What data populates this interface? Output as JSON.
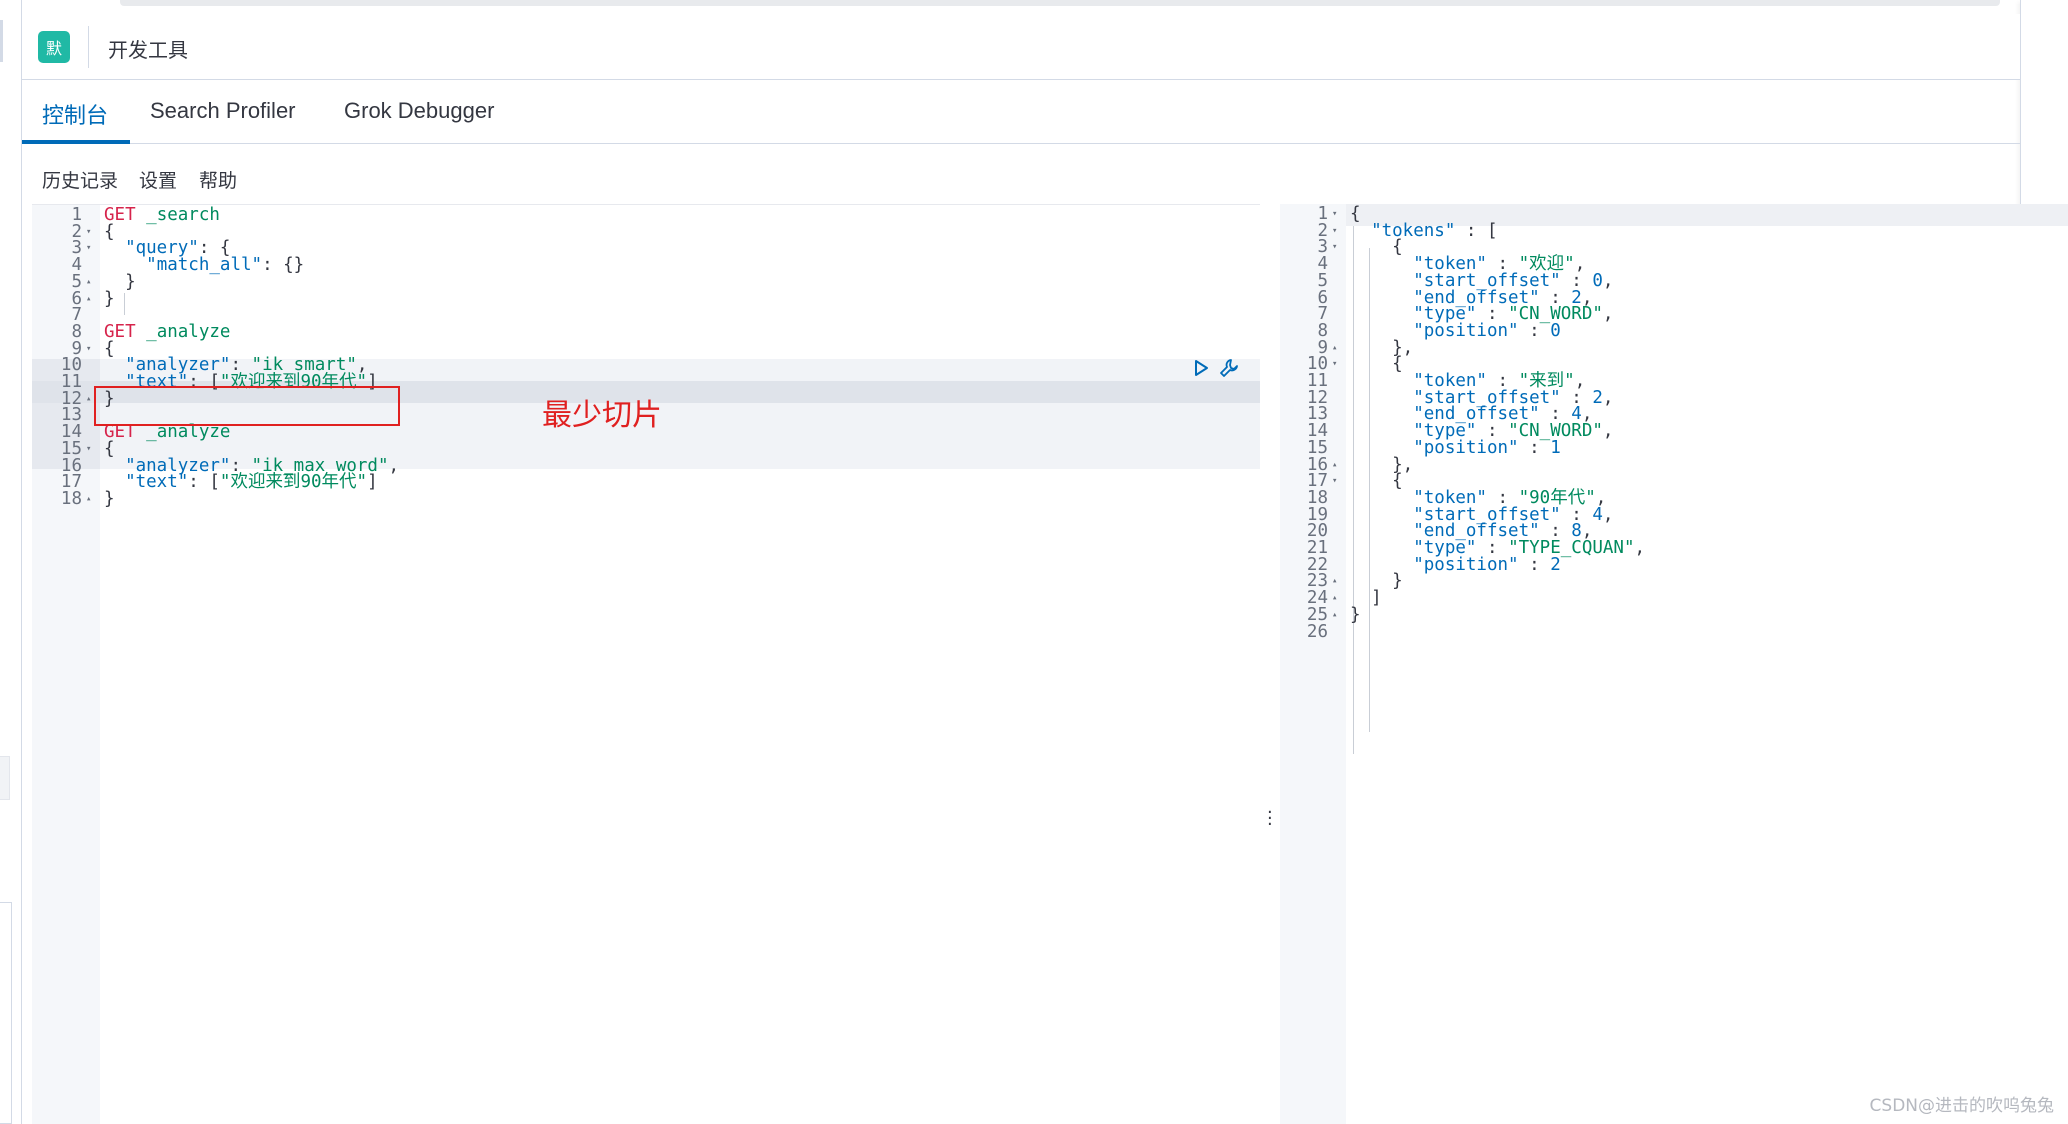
{
  "header": {
    "space_badge": "默",
    "title": "开发工具"
  },
  "tabs": [
    {
      "label": "控制台",
      "active": true
    },
    {
      "label": "Search Profiler",
      "active": false
    },
    {
      "label": "Grok Debugger",
      "active": false
    }
  ],
  "menu": {
    "history": "历史记录",
    "settings": "设置",
    "help": "帮助"
  },
  "annotation": "最少切片",
  "watermark": "CSDN@进击的吹呜兔兔",
  "icons": {
    "run": "play-icon",
    "wrench": "wrench-icon",
    "resize": "vertical-dots-icon"
  },
  "colors": {
    "accent": "#006bb8",
    "method": "#d6234b",
    "string": "#008a5e",
    "annotation": "#e02020",
    "badge": "#20b9a5"
  },
  "request_lines": [
    {
      "n": "1",
      "fold": "",
      "text": "GET _search"
    },
    {
      "n": "2",
      "fold": "▾",
      "text": "{"
    },
    {
      "n": "3",
      "fold": "▾",
      "text": "  \"query\": {"
    },
    {
      "n": "4",
      "fold": "",
      "text": "    \"match_all\": {}"
    },
    {
      "n": "5",
      "fold": "▴",
      "text": "  }"
    },
    {
      "n": "6",
      "fold": "▴",
      "text": "}"
    },
    {
      "n": "7",
      "fold": "",
      "text": ""
    },
    {
      "n": "8",
      "fold": "",
      "text": "GET _analyze"
    },
    {
      "n": "9",
      "fold": "▾",
      "text": "{"
    },
    {
      "n": "10",
      "fold": "",
      "text": "  \"analyzer\": \"ik_smart\","
    },
    {
      "n": "11",
      "fold": "",
      "text": "  \"text\": [\"欢迎来到90年代\"]"
    },
    {
      "n": "12",
      "fold": "▴",
      "text": "}"
    },
    {
      "n": "13",
      "fold": "",
      "text": ""
    },
    {
      "n": "14",
      "fold": "",
      "text": "GET _analyze"
    },
    {
      "n": "15",
      "fold": "▾",
      "text": "{"
    },
    {
      "n": "16",
      "fold": "",
      "text": "  \"analyzer\": \"ik_max_word\","
    },
    {
      "n": "17",
      "fold": "",
      "text": "  \"text\": [\"欢迎来到90年代\"]"
    },
    {
      "n": "18",
      "fold": "▴",
      "text": "}"
    }
  ],
  "response_lines": [
    {
      "n": "1",
      "fold": "▾",
      "text": "{"
    },
    {
      "n": "2",
      "fold": "▾",
      "text": "  \"tokens\" : ["
    },
    {
      "n": "3",
      "fold": "▾",
      "text": "    {"
    },
    {
      "n": "4",
      "fold": "",
      "text": "      \"token\" : \"欢迎\","
    },
    {
      "n": "5",
      "fold": "",
      "text": "      \"start_offset\" : 0,"
    },
    {
      "n": "6",
      "fold": "",
      "text": "      \"end_offset\" : 2,"
    },
    {
      "n": "7",
      "fold": "",
      "text": "      \"type\" : \"CN_WORD\","
    },
    {
      "n": "8",
      "fold": "",
      "text": "      \"position\" : 0"
    },
    {
      "n": "9",
      "fold": "▴",
      "text": "    },"
    },
    {
      "n": "10",
      "fold": "▾",
      "text": "    {"
    },
    {
      "n": "11",
      "fold": "",
      "text": "      \"token\" : \"来到\","
    },
    {
      "n": "12",
      "fold": "",
      "text": "      \"start_offset\" : 2,"
    },
    {
      "n": "13",
      "fold": "",
      "text": "      \"end_offset\" : 4,"
    },
    {
      "n": "14",
      "fold": "",
      "text": "      \"type\" : \"CN_WORD\","
    },
    {
      "n": "15",
      "fold": "",
      "text": "      \"position\" : 1"
    },
    {
      "n": "16",
      "fold": "▴",
      "text": "    },"
    },
    {
      "n": "17",
      "fold": "▾",
      "text": "    {"
    },
    {
      "n": "18",
      "fold": "",
      "text": "      \"token\" : \"90年代\","
    },
    {
      "n": "19",
      "fold": "",
      "text": "      \"start_offset\" : 4,"
    },
    {
      "n": "20",
      "fold": "",
      "text": "      \"end_offset\" : 8,"
    },
    {
      "n": "21",
      "fold": "",
      "text": "      \"type\" : \"TYPE_CQUAN\","
    },
    {
      "n": "22",
      "fold": "",
      "text": "      \"position\" : 2"
    },
    {
      "n": "23",
      "fold": "▴",
      "text": "    }"
    },
    {
      "n": "24",
      "fold": "▴",
      "text": "  ]"
    },
    {
      "n": "25",
      "fold": "▴",
      "text": "}"
    },
    {
      "n": "26",
      "fold": "",
      "text": ""
    }
  ]
}
